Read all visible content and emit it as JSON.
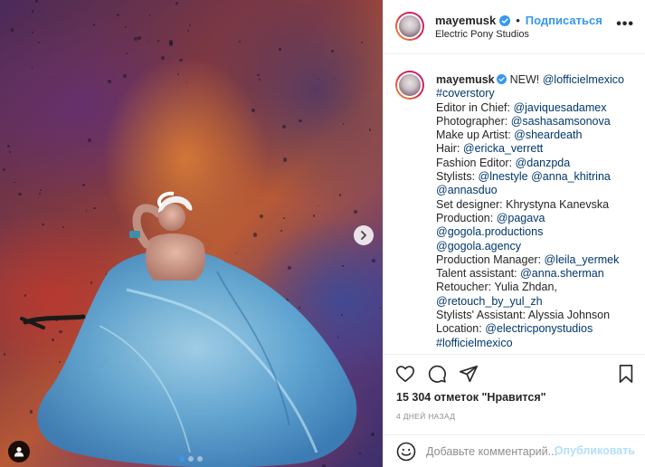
{
  "post": {
    "username": "mayemusk",
    "follow_label": "Подписаться",
    "separator": "•",
    "location": "Electric Pony Studios",
    "more_label": "•••"
  },
  "caption": {
    "username": "mayemusk",
    "lines": [
      [
        {
          "t": "NEW! "
        },
        {
          "t": "@lofficielmexico",
          "link": true
        }
      ],
      [
        {
          "t": "#coverstory",
          "link": true
        }
      ],
      [
        {
          "t": "Editor in Chief: "
        },
        {
          "t": "@javiquesadamex",
          "link": true
        }
      ],
      [
        {
          "t": "Photographer: "
        },
        {
          "t": "@sashasamsonova",
          "link": true
        }
      ],
      [
        {
          "t": "Make up Artist: "
        },
        {
          "t": "@sheardeath",
          "link": true
        }
      ],
      [
        {
          "t": "Hair: "
        },
        {
          "t": "@ericka_verrett",
          "link": true
        }
      ],
      [
        {
          "t": "Fashion Editor: "
        },
        {
          "t": "@danzpda",
          "link": true
        }
      ],
      [
        {
          "t": "Stylists: "
        },
        {
          "t": "@lnestyle",
          "link": true
        },
        {
          "t": " "
        },
        {
          "t": "@anna_khitrina",
          "link": true
        }
      ],
      [
        {
          "t": "@annasduo",
          "link": true
        }
      ],
      [
        {
          "t": "Set designer: Khrystyna Kanevska"
        }
      ],
      [
        {
          "t": "Production: "
        },
        {
          "t": "@pagava",
          "link": true
        }
      ],
      [
        {
          "t": "@gogola.productions",
          "link": true
        }
      ],
      [
        {
          "t": "@gogola.agency",
          "link": true
        }
      ],
      [
        {
          "t": "Production Manager: "
        },
        {
          "t": "@leila_yermek",
          "link": true
        }
      ],
      [
        {
          "t": "Talent assistant: "
        },
        {
          "t": "@anna.sherman",
          "link": true
        }
      ],
      [
        {
          "t": "Retoucher: Yulia Zhdan,"
        }
      ],
      [
        {
          "t": "@retouch_by_yul_zh",
          "link": true
        }
      ],
      [
        {
          "t": "Stylists' Assistant: Alyssia Johnson"
        }
      ],
      [
        {
          "t": "Location: "
        },
        {
          "t": "@electricponystudios",
          "link": true
        }
      ],
      [
        {
          "t": "#lofficielmexico",
          "link": true
        }
      ]
    ]
  },
  "engagement": {
    "likes_text": "15 304 отметок \"Нравится\"",
    "time_text": "4 дней назад"
  },
  "comment": {
    "placeholder": "Добавьте комментарий...",
    "post_label": "Опубликовать"
  },
  "icons": {
    "like": "heart-icon",
    "comment": "comment-icon",
    "share": "paper-plane-icon",
    "save": "bookmark-icon",
    "next": "chevron-right-icon",
    "tag": "user-tag-icon",
    "emoji": "smiley-icon",
    "verified": "verified-badge-icon"
  },
  "carousel": {
    "slide_count": 3,
    "active_index": 0
  },
  "colors": {
    "accent": "#3897f0",
    "link": "#00376b",
    "muted": "#8e8e8e",
    "post_disabled": "#b2dffc"
  }
}
